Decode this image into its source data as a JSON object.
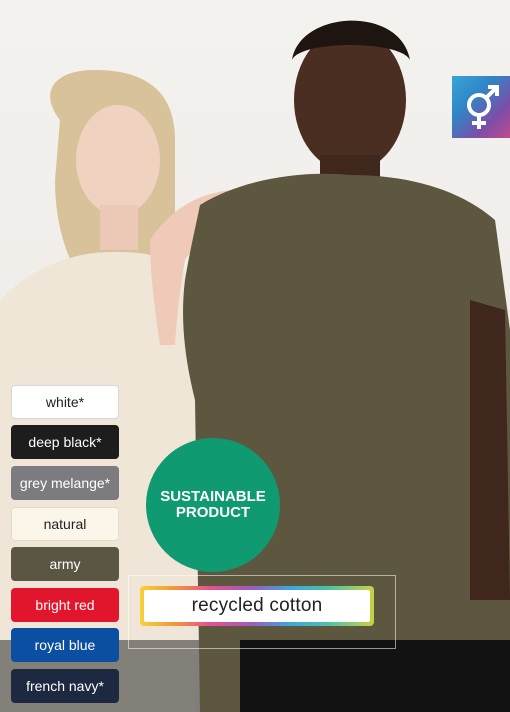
{
  "product": {
    "gender_icon": "unisex-symbol-icon",
    "sustainable_line1": "SUSTAINABLE",
    "sustainable_line2": "PRODUCT",
    "material": "recycled cotton"
  },
  "colors": [
    {
      "label": "white*",
      "hex": "#ffffff"
    },
    {
      "label": "deep black*",
      "hex": "#1d1d1d"
    },
    {
      "label": "grey melange*",
      "hex": "#7c7b7f"
    },
    {
      "label": "natural",
      "hex": "#fbf6e9"
    },
    {
      "label": "army",
      "hex": "#5b5644"
    },
    {
      "label": "bright red",
      "hex": "#e1152c"
    },
    {
      "label": "royal blue",
      "hex": "#0b4fa3"
    },
    {
      "label": "french navy*",
      "hex": "#1c2940"
    }
  ],
  "accent_colors": {
    "sustainable_green": "#0f9a72",
    "army_shirt": "#5b5644"
  }
}
